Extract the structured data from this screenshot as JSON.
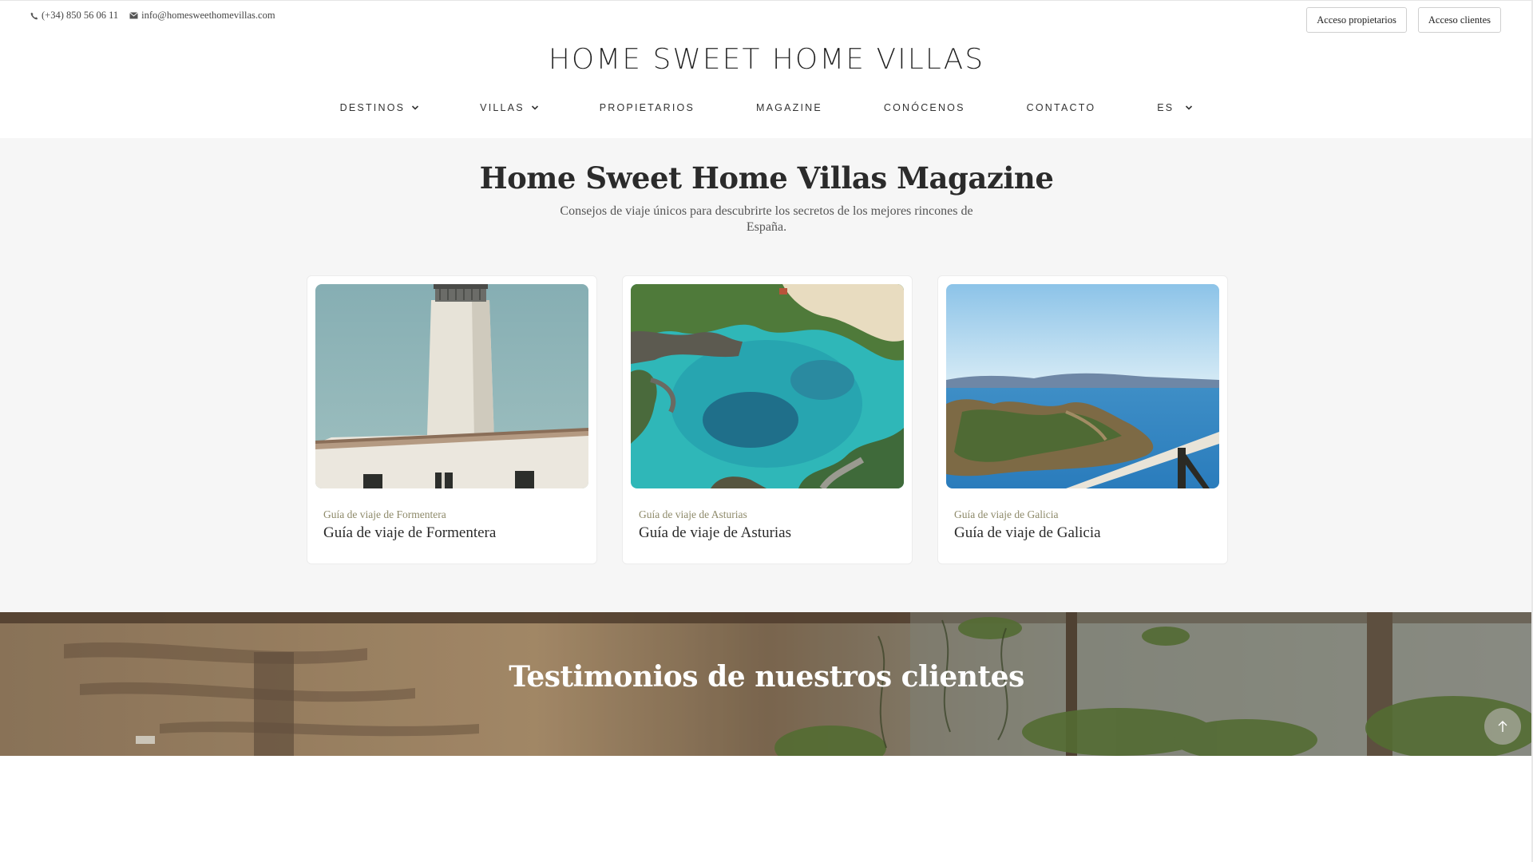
{
  "topbar": {
    "phone": "(+34) 850 56 06 11",
    "email": "info@homesweethomevillas.com",
    "owners_access": "Acceso propietarios",
    "clients_access": "Acceso clientes"
  },
  "logo": {
    "text": "HOME SWEET HOME VILLAS"
  },
  "nav": {
    "items": [
      {
        "label": "DESTINOS",
        "dropdown": true
      },
      {
        "label": "VILLAS",
        "dropdown": true
      },
      {
        "label": "PROPIETARIOS",
        "dropdown": false
      },
      {
        "label": "MAGAZINE",
        "dropdown": false
      },
      {
        "label": "CONÓCENOS",
        "dropdown": false
      },
      {
        "label": "CONTACTO",
        "dropdown": false
      },
      {
        "label": "ES",
        "dropdown": true
      }
    ]
  },
  "magazine": {
    "title": "Home Sweet Home Villas Magazine",
    "subtitle": "Consejos de viaje únicos para descubrirte los secretos de los mejores rincones de España."
  },
  "cards": [
    {
      "category": "Guía de viaje de Formentera",
      "title": "Guía de viaje de Formentera",
      "image": "lighthouse-photo"
    },
    {
      "category": "Guía de viaje de Asturias",
      "title": "Guía de viaje de Asturias",
      "image": "aerial-coast-photo"
    },
    {
      "category": "Guía de viaje de Galicia",
      "title": "Guía de viaje de Galicia",
      "image": "island-coast-photo"
    }
  ],
  "testimonials": {
    "title": "Testimonios de nuestros clientes"
  },
  "colors": {
    "category_text": "#8e8a6a",
    "page_gray": "#f6f6f6"
  },
  "icons": {
    "phone": "phone-icon",
    "email": "envelope-icon",
    "back_to_top": "arrow-up-icon",
    "dropdown": "chevron-down-icon"
  }
}
